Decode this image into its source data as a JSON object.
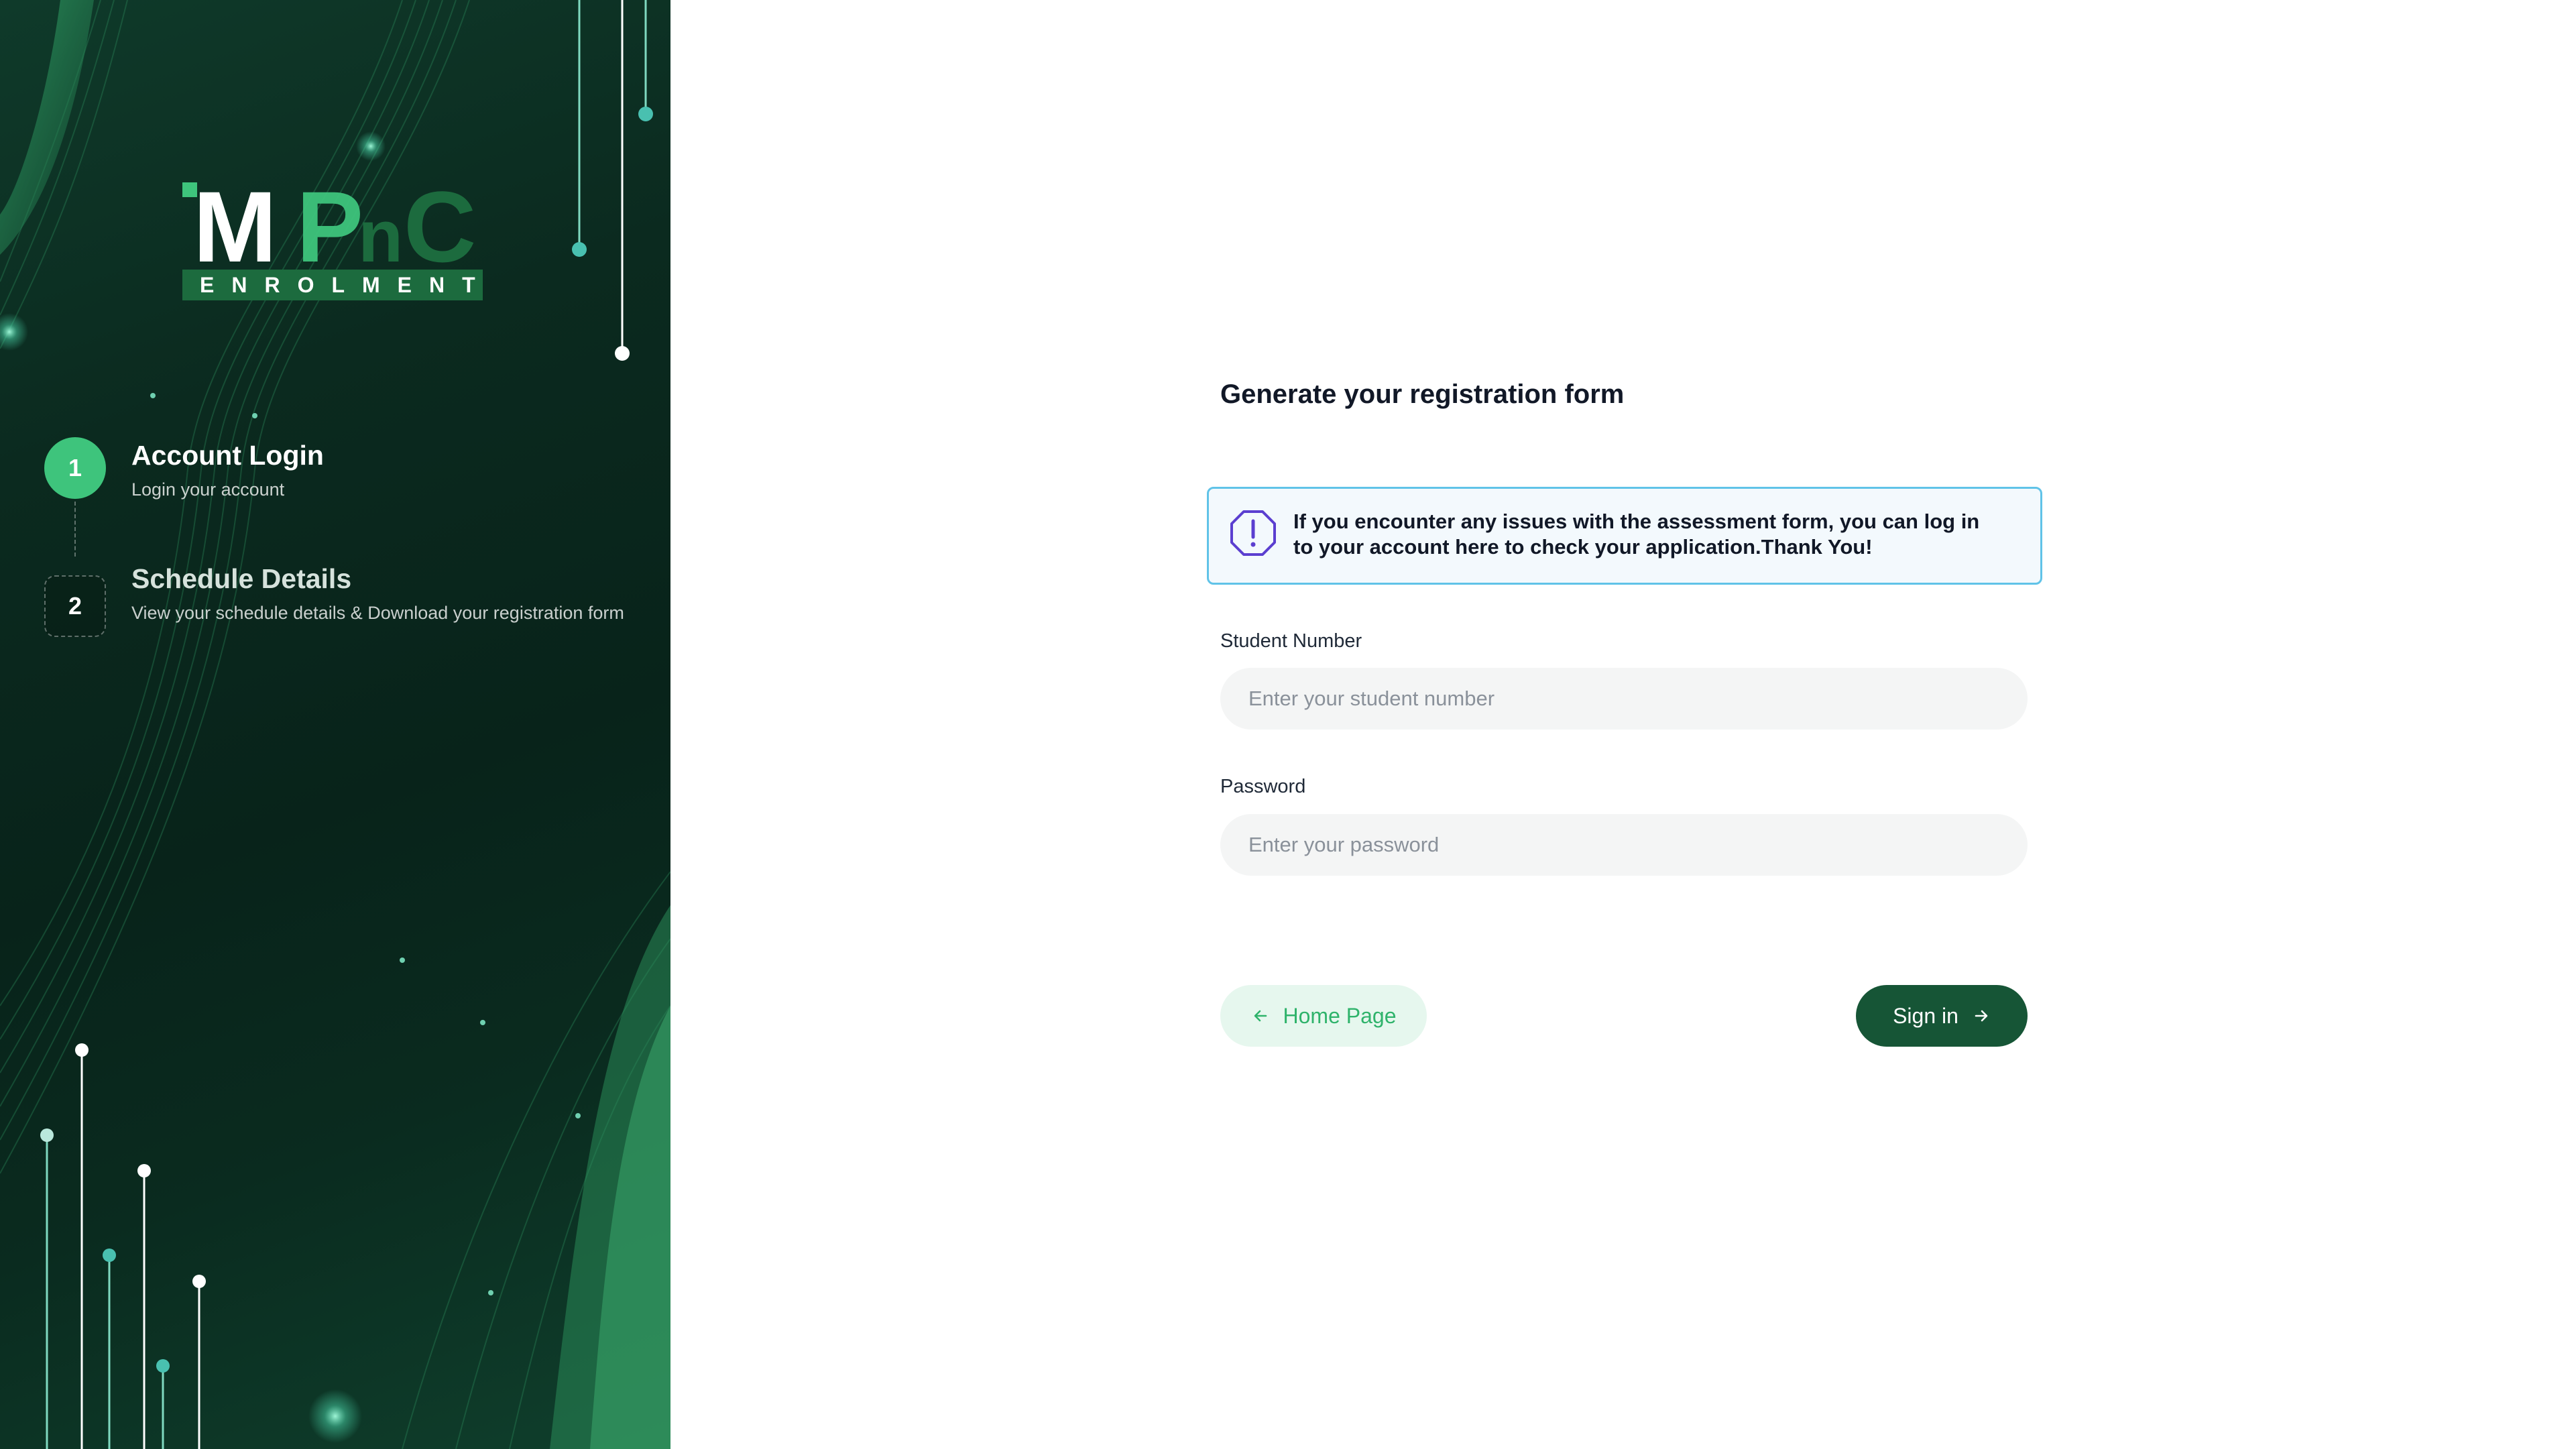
{
  "brand": {
    "logo_text": "MPnC",
    "logo_subtitle": "ENROLMENT"
  },
  "steps": [
    {
      "number": "1",
      "title": "Account Login",
      "subtitle": "Login your account",
      "state": "active"
    },
    {
      "number": "2",
      "title": "Schedule Details",
      "subtitle": "View your schedule details & Download your registration form",
      "state": "pending"
    }
  ],
  "form": {
    "title": "Generate your registration form",
    "notice": "If you encounter any issues with the assessment form, you can log in to your account here to check your application.Thank You!",
    "student_number": {
      "label": "Student Number",
      "placeholder": "Enter your student number",
      "value": ""
    },
    "password": {
      "label": "Password",
      "placeholder": "Enter your password",
      "value": ""
    },
    "home_button": "Home Page",
    "signin_button": "Sign in"
  },
  "icons": {
    "notice": "alert-octagon-icon",
    "home": "arrow-left-icon",
    "signin": "arrow-right-icon"
  },
  "colors": {
    "brand_dark_green": "#165536",
    "step_active": "#3ec47c",
    "notice_border": "#60c3e8",
    "notice_icon": "#5b3fd0",
    "home_button_bg": "#e6f7ee",
    "home_button_text": "#2fb36b"
  }
}
